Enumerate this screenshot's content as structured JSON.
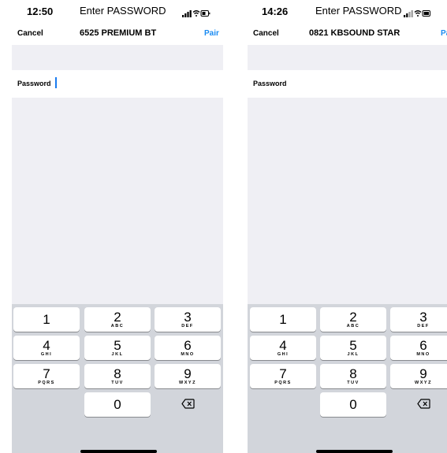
{
  "screens": [
    {
      "time": "12:50",
      "title": "Enter PASSWORD",
      "cancel_label": "Cancel",
      "device_name": "6525 PREMIUM BT",
      "pair_label": "Pair",
      "password_label": "Password"
    },
    {
      "time": "14:26",
      "title": "Enter PASSWORD",
      "cancel_label": "Cancel",
      "device_name": "0821 KBSOUND STAR",
      "pair_label": "Pa",
      "password_label": "Password"
    }
  ],
  "keypad": [
    {
      "num": "1",
      "letters": ""
    },
    {
      "num": "2",
      "letters": "ABC"
    },
    {
      "num": "3",
      "letters": "DEF"
    },
    {
      "num": "4",
      "letters": "GHI"
    },
    {
      "num": "5",
      "letters": "JKL"
    },
    {
      "num": "6",
      "letters": "MNO"
    },
    {
      "num": "7",
      "letters": "PQRS"
    },
    {
      "num": "8",
      "letters": "TUV"
    },
    {
      "num": "9",
      "letters": "WXYZ"
    },
    {
      "num": "0",
      "letters": ""
    }
  ],
  "icons": {
    "cellular": "cellular-signal-icon",
    "wifi": "wifi-icon",
    "battery": "battery-icon",
    "delete": "backspace-icon"
  },
  "colors": {
    "accent": "#1a8bf2",
    "keyboard_bg": "#d2d5db",
    "panel_bg": "#efeff4"
  }
}
